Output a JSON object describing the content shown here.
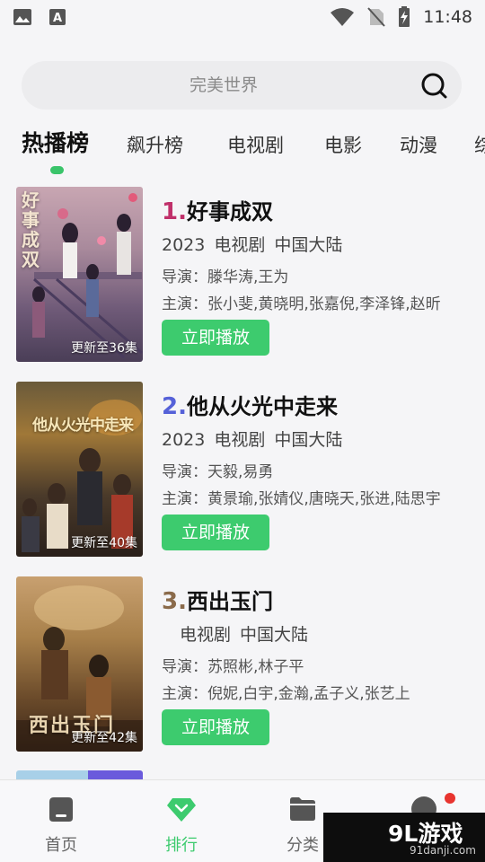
{
  "status_bar": {
    "time": "11:48",
    "icons": [
      "image-icon",
      "text-a-icon",
      "wifi-icon",
      "no-sim-icon",
      "battery-charging-icon"
    ]
  },
  "search": {
    "placeholder": "完美世界",
    "icon": "search-icon"
  },
  "tabs": [
    "热播榜",
    "飙升榜",
    "电视剧",
    "电影",
    "动漫",
    "综"
  ],
  "active_tab": "热播榜",
  "items": [
    {
      "rank": "1.",
      "rank_color": "#c0306a",
      "title": "好事成双",
      "year": "2023",
      "genre": "电视剧",
      "region": "中国大陆",
      "director": "导演：滕华涛,王为",
      "cast": "主演：张小斐,黄晓明,张嘉倪,李泽锋,赵昕",
      "update": "更新至36集",
      "poster_text": "好事成双",
      "button": "立即播放"
    },
    {
      "rank": "2.",
      "rank_color": "#5561d8",
      "title": "他从火光中走来",
      "year": "2023",
      "genre": "电视剧",
      "region": "中国大陆",
      "director": "导演：天毅,易勇",
      "cast": "主演：黄景瑜,张婧仪,唐晓天,张进,陆思宇",
      "update": "更新至40集",
      "poster_text": "他从火光中走来",
      "button": "立即播放"
    },
    {
      "rank": "3.",
      "rank_color": "#8a6a4a",
      "title": "西出玉门",
      "year": "",
      "genre": "电视剧",
      "region": "中国大陆",
      "director": "导演：苏照彬,林子平",
      "cast": "主演：倪妮,白宇,金瀚,孟子义,张艺上",
      "update": "更新至42集",
      "poster_text": "西出玉门",
      "button": "立即播放"
    }
  ],
  "bottom_nav": [
    {
      "label": "首页",
      "icon": "home-icon"
    },
    {
      "label": "排行",
      "icon": "rank-diamond-icon",
      "active": true
    },
    {
      "label": "分类",
      "icon": "folder-icon"
    },
    {
      "label": "",
      "icon": "profile-icon",
      "badge": true
    }
  ],
  "watermark": {
    "logo": "9L游戏",
    "url": "91danji.com"
  },
  "colors": {
    "accent": "#3dcb6e",
    "background": "#f5f5f7"
  }
}
